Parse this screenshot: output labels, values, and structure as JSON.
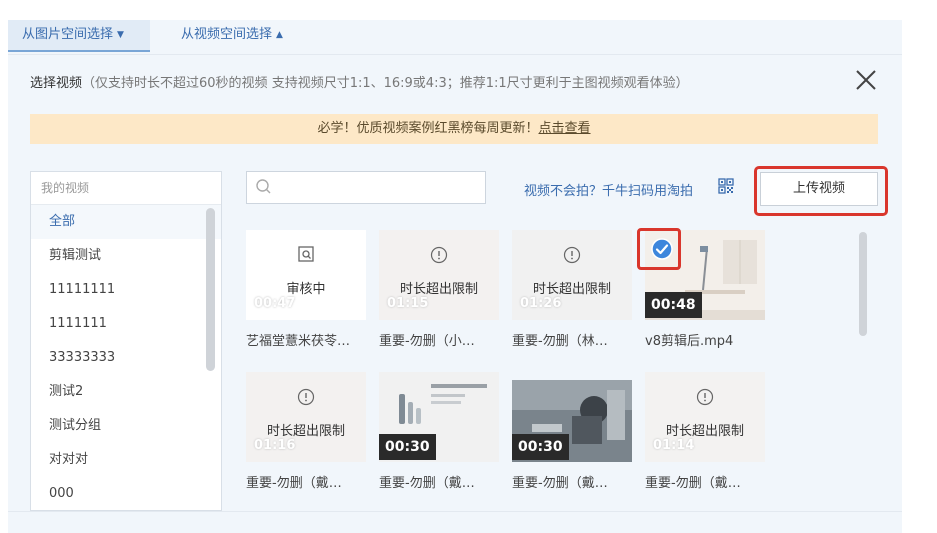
{
  "tabs": [
    {
      "label": "从图片空间选择",
      "caret": "▼"
    },
    {
      "label": "从视频空间选择",
      "caret": "▲"
    }
  ],
  "info": {
    "title": "选择视频",
    "note": "（仅支持时长不超过60秒的视频 支持视频尺寸1:1、16:9或4:3；推荐1:1尺寸更利于主图视频观看体验）"
  },
  "banner": {
    "text": "必学！优质视频案例红黑榜每周更新！",
    "link": "点击查看"
  },
  "sidebar": {
    "header": "我的视频",
    "items": [
      "全部",
      "剪辑测试",
      "11111111",
      "1111111",
      "33333333",
      "测试2",
      "测试分组",
      "对对对",
      "000"
    ]
  },
  "search": {
    "placeholder": ""
  },
  "toolbar": {
    "help_text": "视频不会拍？千牛扫码用淘拍",
    "upload_label": "上传视频"
  },
  "videos": [
    {
      "status": "审核中",
      "duration": "00:47",
      "name": "艺福堂薏米茯苓…"
    },
    {
      "status": "时长超出限制",
      "duration": "01:15",
      "name": "重要-勿删（小…"
    },
    {
      "status": "时长超出限制",
      "duration": "01:26",
      "name": "重要-勿删（林…"
    },
    {
      "status": "",
      "duration": "00:48",
      "name": "v8剪辑后.mp4",
      "selected": true
    },
    {
      "status": "时长超出限制",
      "duration": "01:16",
      "name": "重要-勿删（戴…"
    },
    {
      "status": "",
      "duration": "00:30",
      "name": "重要-勿删（戴…"
    },
    {
      "status": "",
      "duration": "00:30",
      "name": "重要-勿删（戴…"
    },
    {
      "status": "时长超出限制",
      "duration": "01:14",
      "name": "重要-勿删（戴…"
    }
  ],
  "colors": {
    "accent": "#3a6cae",
    "highlight_border": "#d9362c",
    "check_blue": "#3d86dc",
    "banner_bg": "#fde8c7"
  }
}
